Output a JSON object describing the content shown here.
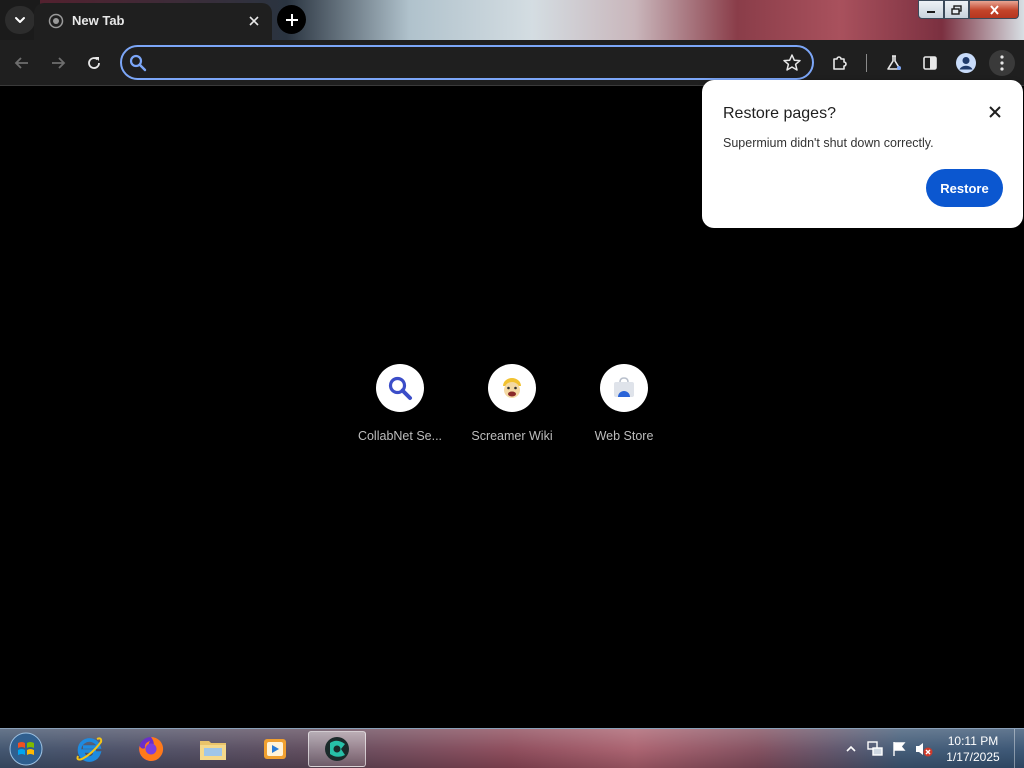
{
  "browser": {
    "tab_title": "New Tab",
    "omnibox_value": "",
    "omnibox_placeholder": ""
  },
  "shortcuts": [
    {
      "label": "CollabNet Se...",
      "icon": "magnifier-icon"
    },
    {
      "label": "Screamer Wiki",
      "icon": "screamer-face-icon"
    },
    {
      "label": "Web Store",
      "icon": "web-store-icon"
    }
  ],
  "popup": {
    "title": "Restore pages?",
    "message": "Supermium didn't shut down correctly.",
    "button_label": "Restore"
  },
  "taskbar": {
    "apps": [
      "internet-explorer-icon",
      "firefox-icon",
      "file-explorer-icon",
      "media-player-icon",
      "supermium-icon"
    ],
    "clock_time": "10:11 PM",
    "clock_date": "1/17/2025"
  },
  "colors": {
    "accent": "#0b57d0",
    "omnibox_border": "#7ca6f7",
    "toolbar_bg": "#1f1f1f",
    "page_bg": "#000000"
  }
}
